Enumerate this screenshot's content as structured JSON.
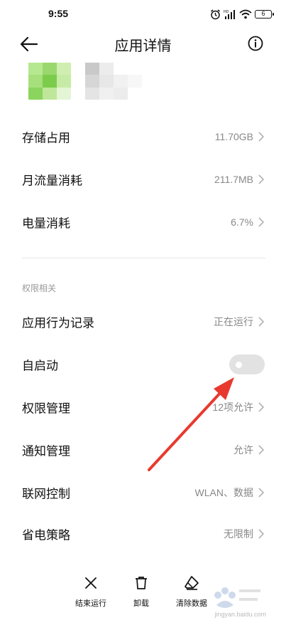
{
  "status_bar": {
    "time": "9:55",
    "battery": "6"
  },
  "header": {
    "title": "应用详情"
  },
  "app": {
    "icon_colors": [
      "#b6e88f",
      "#9ad86d",
      "#cfeeb0",
      "#a6df7c",
      "#7ccc4b",
      "#c6eba6",
      "#8bd55e",
      "#bfe79a",
      "#e3f5d4"
    ]
  },
  "usage_rows": [
    {
      "label": "存储占用",
      "value": "11.70GB"
    },
    {
      "label": "月流量消耗",
      "value": "211.7MB"
    },
    {
      "label": "电量消耗",
      "value": "6.7%"
    }
  ],
  "permissions": {
    "section_title": "权限相关",
    "rows": [
      {
        "label": "应用行为记录",
        "value": "正在运行"
      },
      {
        "label": "自启动",
        "toggle_on": false
      },
      {
        "label": "权限管理",
        "value": "12项允许"
      },
      {
        "label": "通知管理",
        "value": "允许"
      },
      {
        "label": "联网控制",
        "value": "WLAN、数据"
      },
      {
        "label": "省电策略",
        "value": "无限制"
      }
    ]
  },
  "bottom_bar": {
    "force_stop": "结束运行",
    "uninstall": "卸载",
    "clear_data": "清除数据"
  },
  "watermark": {
    "text": "jingyan.baidu.com"
  },
  "colors": {
    "arrow": "#e8392e",
    "toggle_off": "#e2e2e2"
  }
}
